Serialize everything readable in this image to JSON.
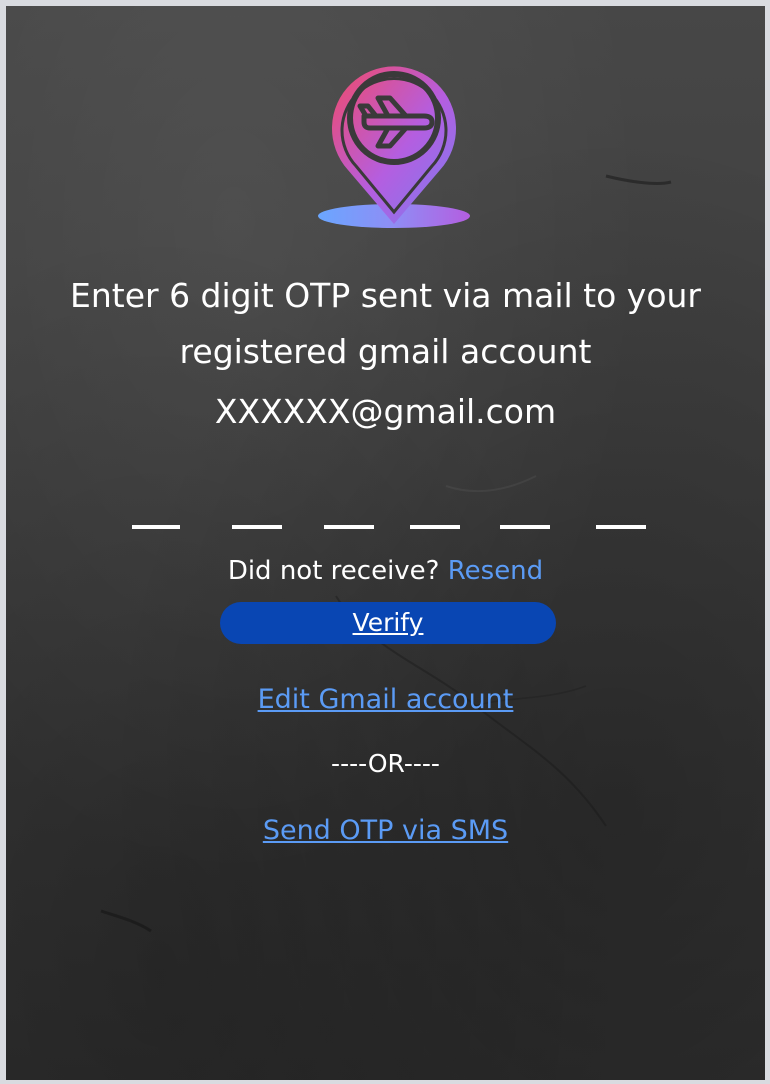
{
  "header": {
    "logo_icon": "airplane-location-pin-icon",
    "title_line1": "Enter 6 digit OTP sent via mail to your",
    "title_line2": "registered gmail account",
    "email": "XXXXXX@gmail.com"
  },
  "otp": {
    "digit_count": 6,
    "digits": [
      "",
      "",
      "",
      "",
      "",
      ""
    ]
  },
  "resend": {
    "prompt": "Did not receive?",
    "link_label": "Resend"
  },
  "actions": {
    "verify_label": "Verify",
    "edit_account_label": "Edit Gmail account",
    "divider_label": "----OR----",
    "sms_label": "Send OTP via SMS"
  },
  "colors": {
    "accent_button": "#0946b3",
    "link": "#5b9bf5",
    "text": "#ffffff",
    "logo_gradient_start": "#f04a6a",
    "logo_gradient_mid": "#b45ee0",
    "logo_gradient_end": "#6aa6ff"
  }
}
